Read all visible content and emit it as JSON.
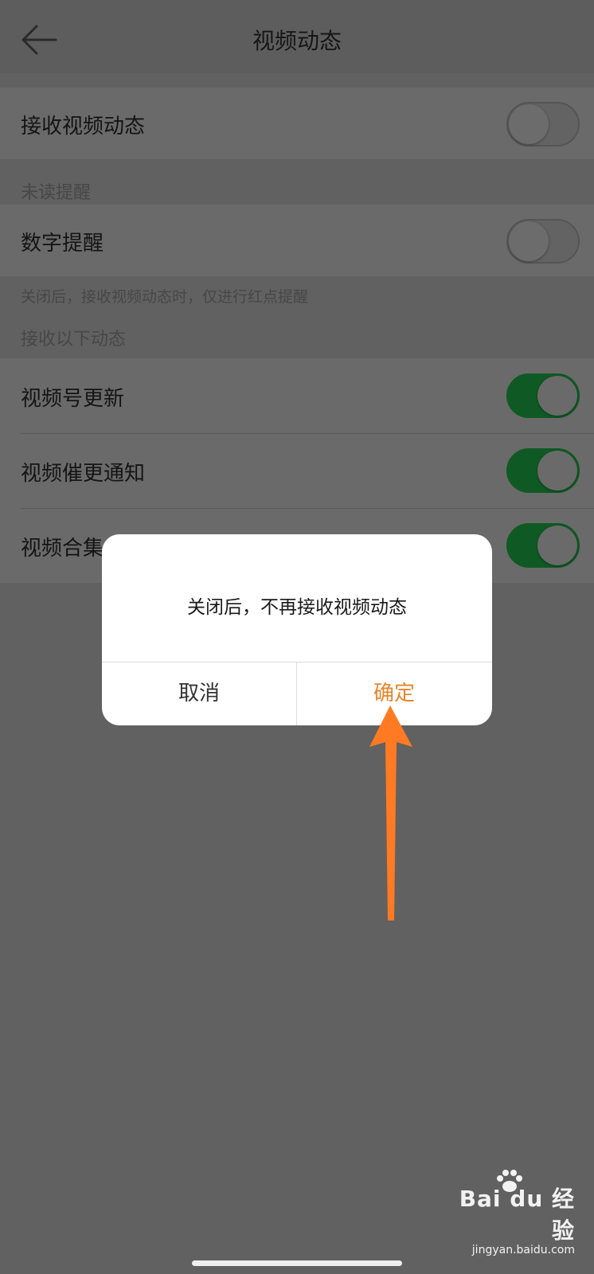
{
  "header": {
    "title": "视频动态"
  },
  "settings": {
    "receive_video_dynamics": {
      "label": "接收视频动态",
      "enabled": false
    },
    "unread_section": "未读提醒",
    "number_reminder": {
      "label": "数字提醒",
      "enabled": false
    },
    "number_reminder_note": "关闭后，接收视频动态时，仅进行红点提醒",
    "receive_section": "接收以下动态",
    "items": [
      {
        "label": "视频号更新",
        "enabled": true
      },
      {
        "label": "视频催更通知",
        "enabled": true
      },
      {
        "label": "视频合集",
        "enabled": true
      }
    ]
  },
  "dialog": {
    "message": "关闭后，不再接收视频动态",
    "cancel_label": "取消",
    "confirm_label": "确定"
  },
  "watermark": {
    "brand": "Bai du 经验",
    "url": "jingyan.baidu.com"
  },
  "colors": {
    "accent_orange": "#e8852a",
    "toggle_on": "#0f5a24",
    "arrow": "#ff7a22",
    "overlay_background": "#616161"
  },
  "icons": {
    "back": "arrow-left-icon",
    "annotation": "arrow-up-icon",
    "logo": "paw-icon"
  }
}
